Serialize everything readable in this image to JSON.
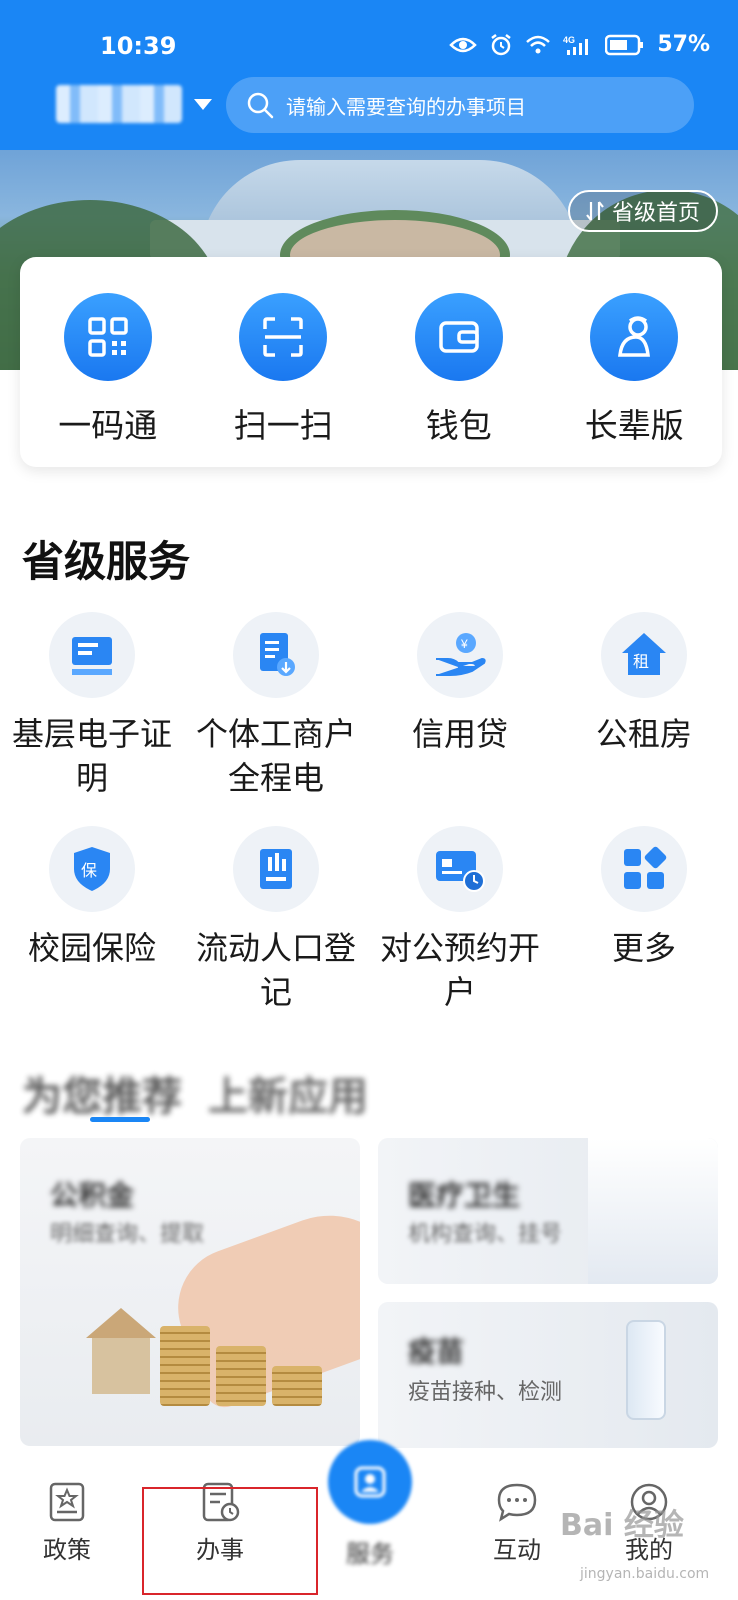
{
  "status_bar": {
    "time": "10:39",
    "battery": "57%"
  },
  "header": {
    "city": "",
    "search_placeholder": "请输入需要查询的办事项目"
  },
  "banner": {
    "province_home": "省级首页"
  },
  "quick_actions": [
    {
      "label": "一码通",
      "icon": "qr-code-icon"
    },
    {
      "label": "扫一扫",
      "icon": "scan-icon"
    },
    {
      "label": "钱包",
      "icon": "wallet-icon"
    },
    {
      "label": "长辈版",
      "icon": "elder-icon"
    }
  ],
  "section": {
    "title": "省级服务"
  },
  "services": [
    {
      "label": "基层电子证明",
      "icon": "certificate-icon"
    },
    {
      "label": "个体工商户全程电",
      "icon": "document-download-icon"
    },
    {
      "label": "信用贷",
      "icon": "loan-hand-icon"
    },
    {
      "label": "公租房",
      "icon": "house-rent-icon"
    },
    {
      "label": "校园保险",
      "icon": "shield-insurance-icon"
    },
    {
      "label": "流动人口登记",
      "icon": "register-icon"
    },
    {
      "label": "对公预约开户",
      "icon": "card-clock-icon"
    },
    {
      "label": "更多",
      "icon": "grid-more-icon"
    }
  ],
  "tabs": [
    {
      "label": "为您推荐"
    },
    {
      "label": "上新应用"
    }
  ],
  "cards": {
    "big": {
      "title": "公积金",
      "subtitle": "明细查询、提取"
    },
    "small1": {
      "title": "医疗卫生",
      "subtitle": "机构查询、挂号"
    },
    "small2": {
      "title": "疫苗",
      "subtitle": "疫苗接种、检测"
    }
  },
  "bottom_nav": [
    {
      "label": "政策"
    },
    {
      "label": "办事"
    },
    {
      "label": "服务"
    },
    {
      "label": "互动"
    },
    {
      "label": "我的"
    }
  ],
  "watermark": {
    "text": "Bai 经验",
    "sub": "jingyan.baidu.com"
  },
  "colors": {
    "primary": "#1a86f5",
    "highlight": "#d9252b"
  }
}
